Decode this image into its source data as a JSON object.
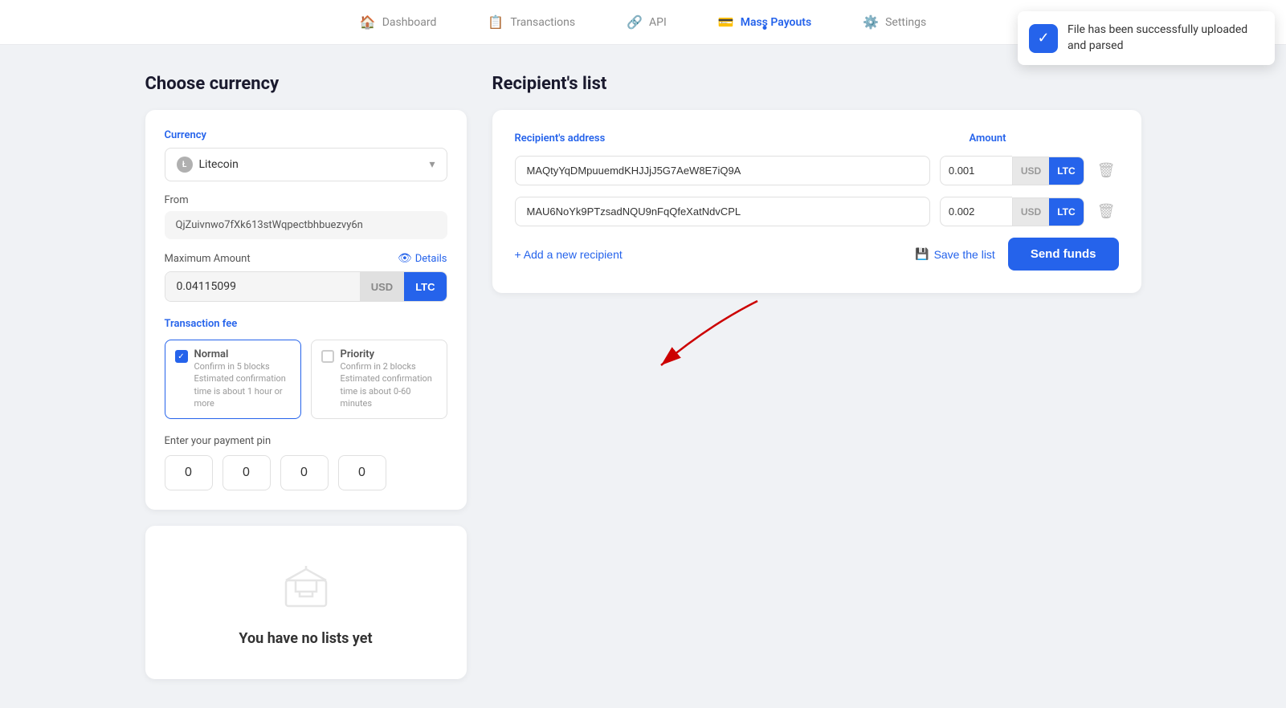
{
  "nav": {
    "items": [
      {
        "id": "dashboard",
        "label": "Dashboard",
        "icon": "🏠",
        "active": false
      },
      {
        "id": "transactions",
        "label": "Transactions",
        "icon": "📋",
        "active": false
      },
      {
        "id": "api",
        "label": "API",
        "icon": "🔗",
        "active": false
      },
      {
        "id": "mass-payouts",
        "label": "Mass Payouts",
        "icon": "💳",
        "active": true
      },
      {
        "id": "settings",
        "label": "Settings",
        "icon": "⚙️",
        "active": false
      }
    ]
  },
  "toast": {
    "message": "File has been successfully uploaded and parsed"
  },
  "left": {
    "title": "Choose currency",
    "currency_label": "Currency",
    "currency_value": "Litecoin",
    "from_label": "From",
    "from_value": "QjZuivnwo7fXk613stWqpectbhbuezvy6n",
    "max_amount_label": "Maximum Amount",
    "details_label": "Details",
    "amount_value": "0.04115099",
    "usd_btn": "USD",
    "ltc_btn": "LTC",
    "fee_label": "Transaction fee",
    "fee_normal_name": "Normal",
    "fee_normal_desc": "Confirm in 5 blocks",
    "fee_normal_est": "Estimated confirmation time is about 1 hour or more",
    "fee_priority_name": "Priority",
    "fee_priority_desc": "Confirm in 2 blocks",
    "fee_priority_est": "Estimated confirmation time is about 0-60 minutes",
    "pin_label": "Enter your payment pin",
    "pin_values": [
      "0",
      "0",
      "0",
      "0"
    ]
  },
  "no_lists": {
    "text": "You have no lists yet"
  },
  "right": {
    "title": "Recipient's list",
    "address_label": "Recipient's address",
    "amount_label": "Amount",
    "recipients": [
      {
        "address": "MAQtyYqDMpuuemdKHJJjJ5G7AeW8E7iQ9A",
        "amount": "0.001",
        "usd": "USD",
        "ltc": "LTC"
      },
      {
        "address": "MAU6NoYk9PTzsadNQU9nFqQfeXatNdvCPL",
        "amount": "0.002",
        "usd": "USD",
        "ltc": "LTC"
      }
    ],
    "add_recipient_label": "+ Add a new recipient",
    "save_list_label": "Save the list",
    "send_funds_label": "Send funds"
  }
}
